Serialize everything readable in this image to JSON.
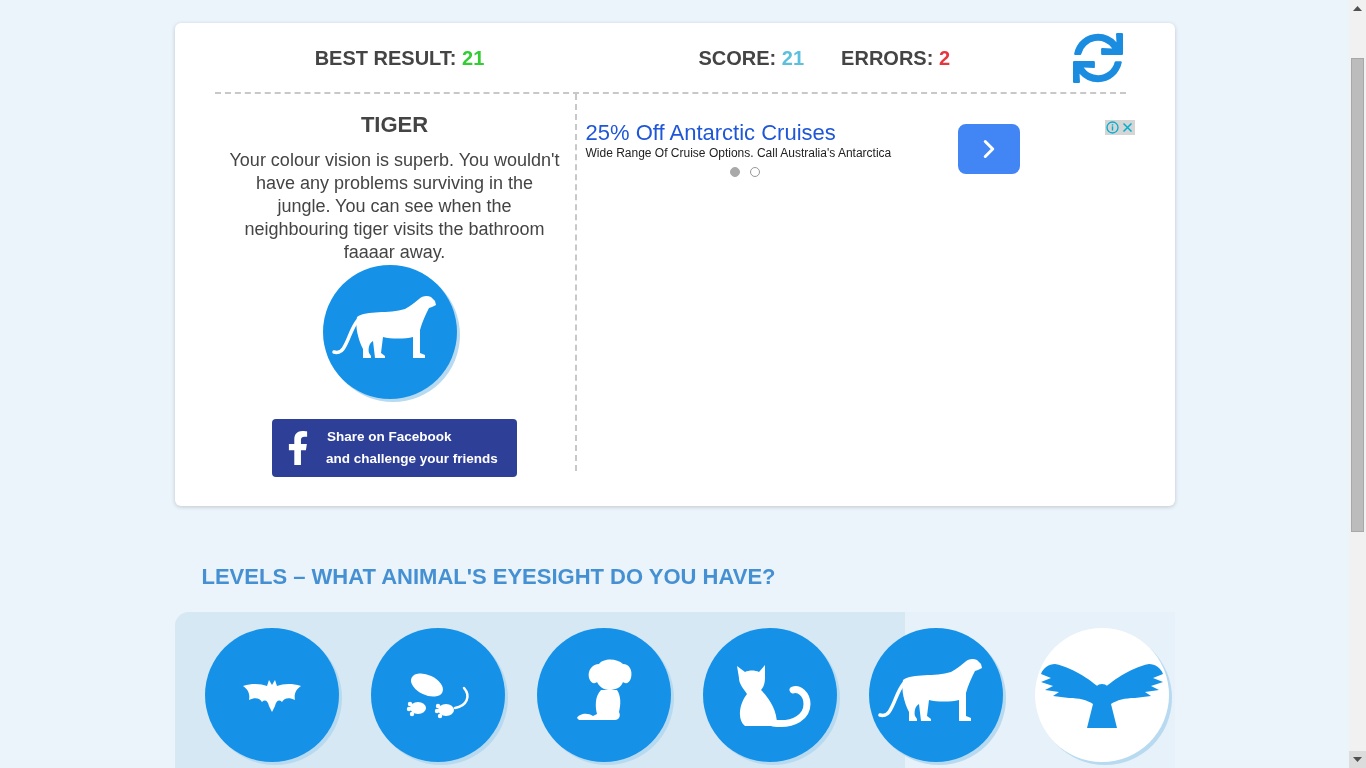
{
  "header": {
    "stats": [
      {
        "label": "BEST RESULT:",
        "value": "21",
        "color": "#33cc33"
      },
      {
        "label": "SCORE:",
        "value": "21",
        "color": "#5bc0de"
      },
      {
        "label": "ERRORS:",
        "value": "2",
        "color": "#e8363f"
      }
    ]
  },
  "result": {
    "title": "TIGER",
    "description_lines": [
      "Your colour vision is superb. You wouldn't",
      "have any problems surviving in the",
      "jungle. You can see when the",
      "neighbouring tiger visits the bathroom",
      "faaaar away."
    ],
    "kind": "tiger",
    "share_button": {
      "lines": [
        "Share on Facebook",
        "and challenge your friends"
      ]
    }
  },
  "ad": {
    "headline": "25% Off Antarctic Cruises",
    "text": "Wide Range Of Cruise Options. Call Australia's Antarctica",
    "slides": [
      {
        "selected": true
      },
      {
        "selected": false
      }
    ]
  },
  "levels": {
    "title": "LEVELS – WHAT ANIMAL'S EYESIGHT DO YOU HAVE?",
    "progress": {
      "level": 0.73
    },
    "items": [
      {
        "kind": "bat",
        "reached": true
      },
      {
        "kind": "mole",
        "reached": true
      },
      {
        "kind": "dog",
        "reached": true
      },
      {
        "kind": "cat",
        "reached": true
      },
      {
        "kind": "tiger",
        "reached": true
      },
      {
        "kind": "eagle",
        "reached": false
      }
    ]
  }
}
